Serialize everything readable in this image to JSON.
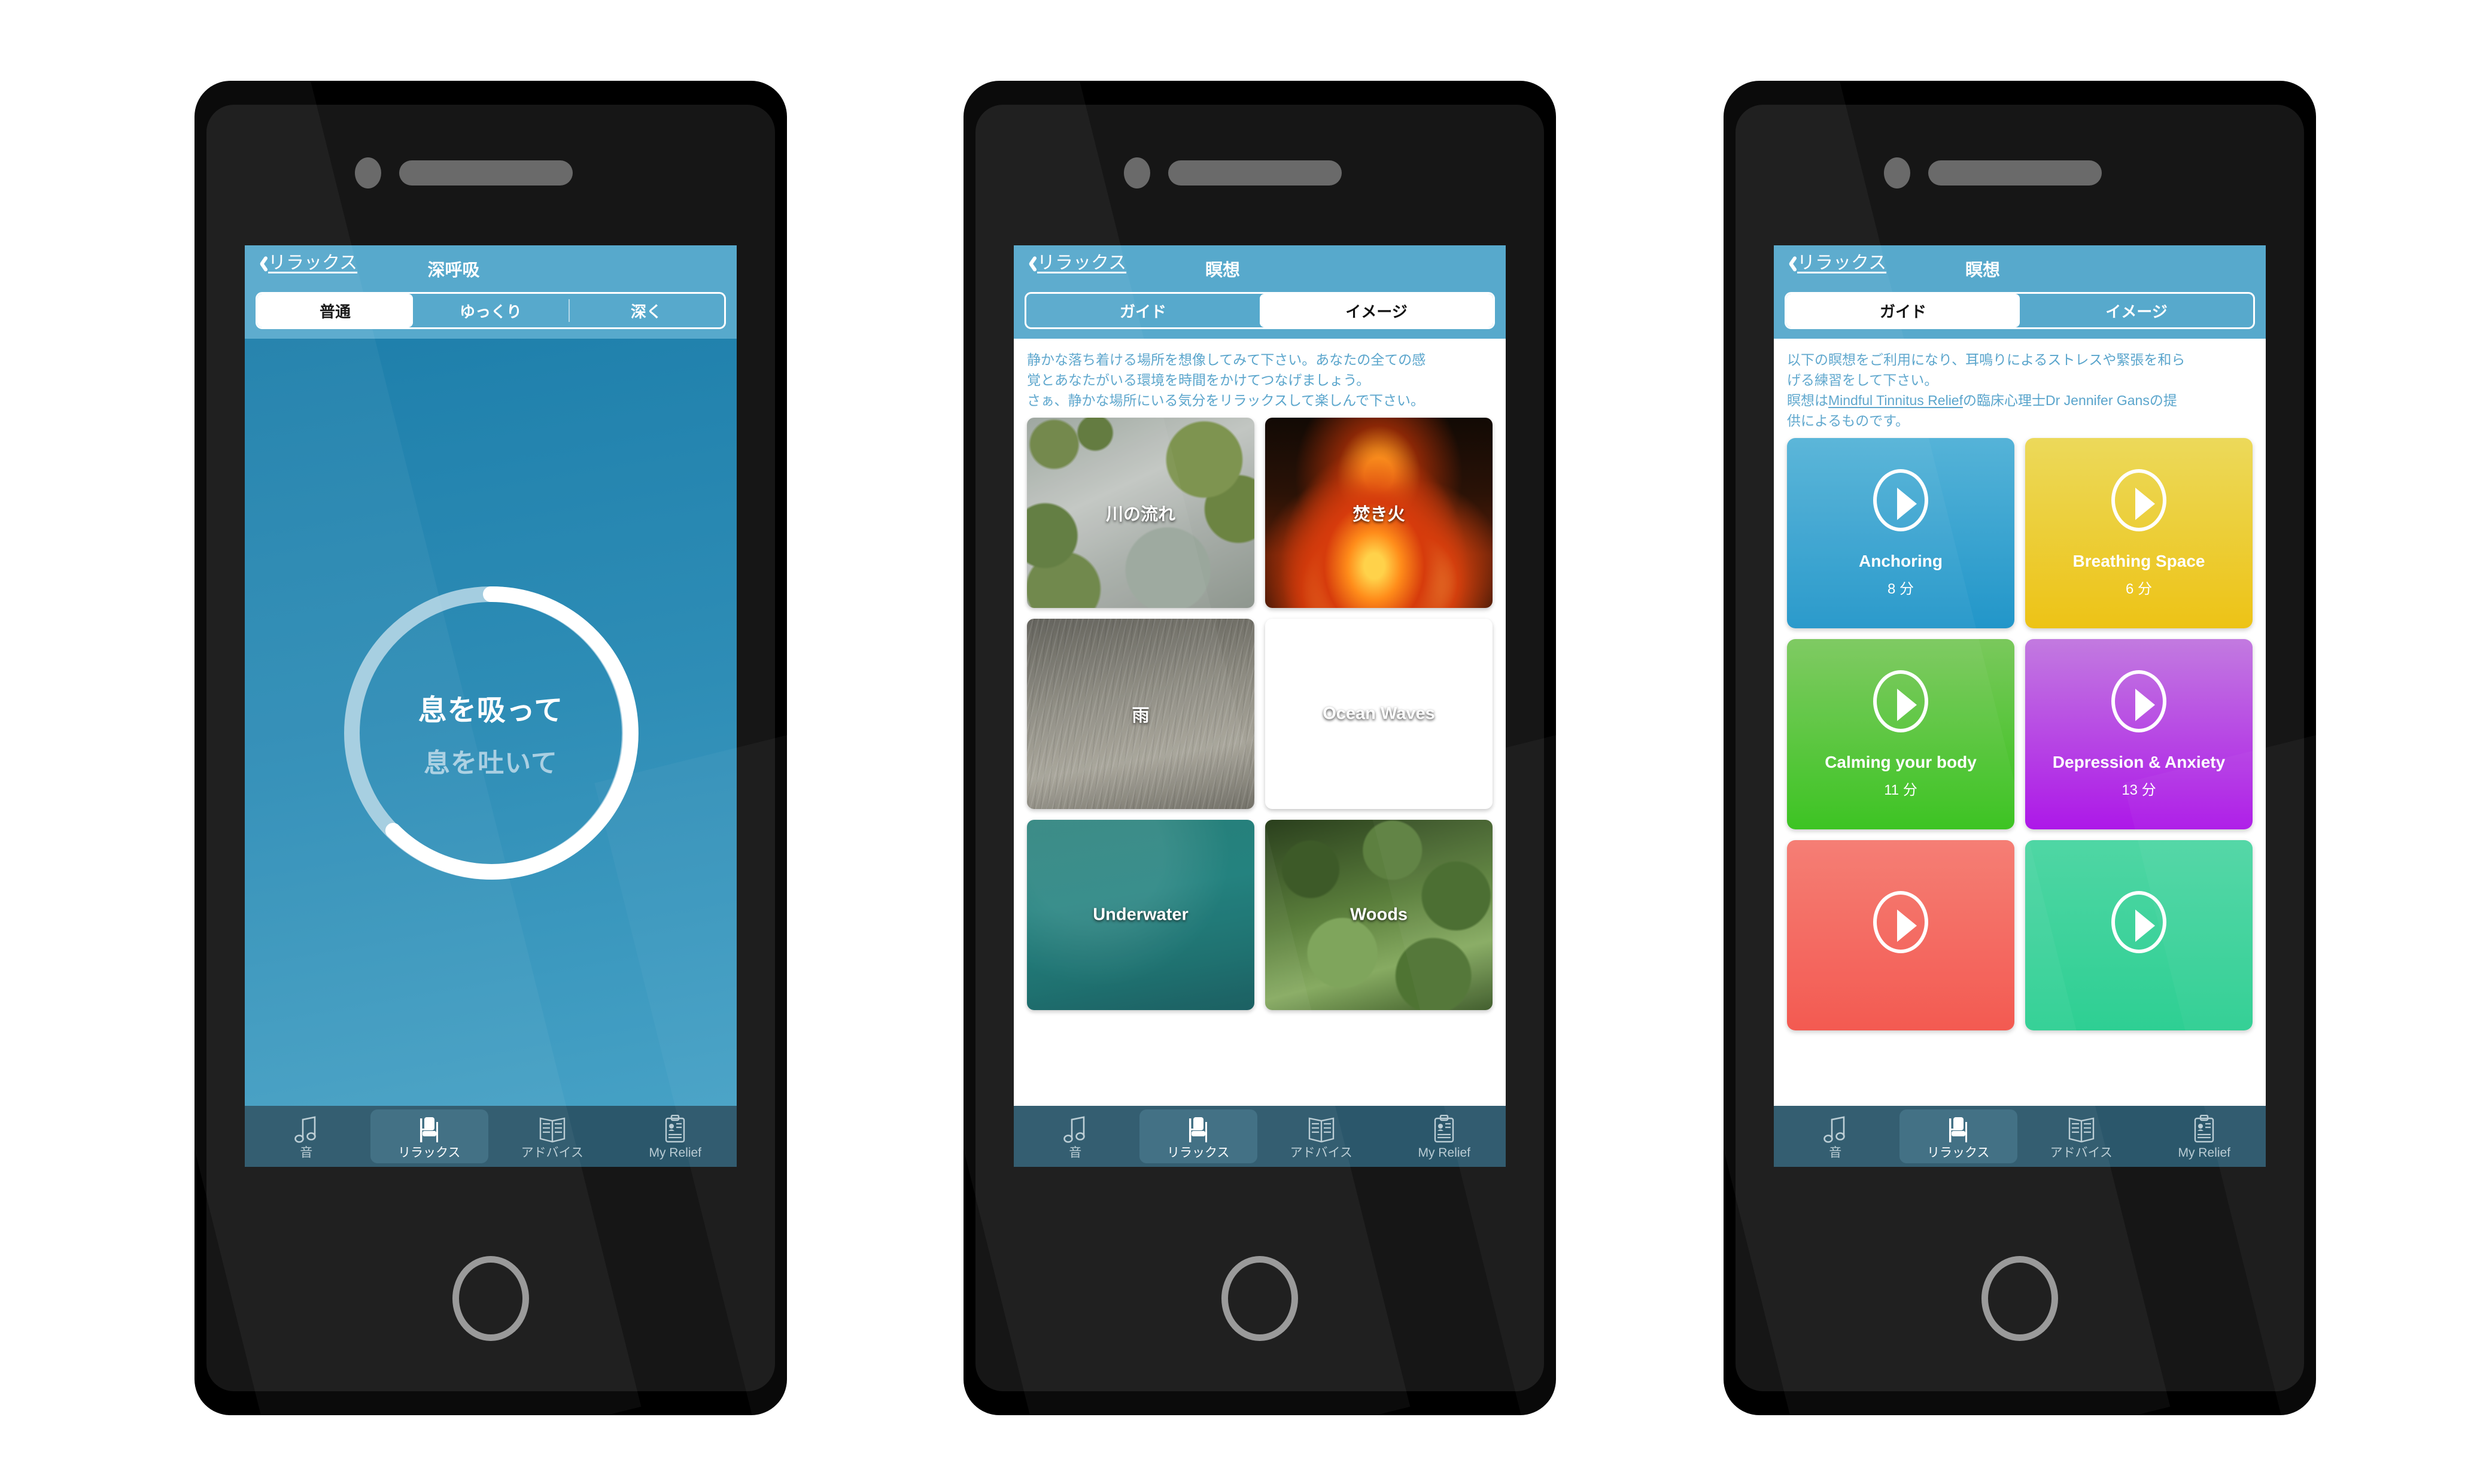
{
  "app": {
    "accent_blue": "#57a9cc",
    "tabbar_bg": "#2b576b",
    "tabbar_active_bg": "#3b6b80"
  },
  "tabbar": {
    "items": [
      {
        "icon": "music-note-icon",
        "label": "音",
        "active": false
      },
      {
        "icon": "chair-icon",
        "label": "リラックス",
        "active": true
      },
      {
        "icon": "book-icon",
        "label": "アドバイス",
        "active": false
      },
      {
        "icon": "clipboard-icon",
        "label": "My Relief",
        "active": false
      }
    ]
  },
  "phone1": {
    "nav": {
      "back_label": "リラックス",
      "title": "深呼吸"
    },
    "segments": [
      {
        "label": "普通",
        "active": true
      },
      {
        "label": "ゆっくり",
        "active": false
      },
      {
        "label": "深く",
        "active": false
      }
    ],
    "breathing": {
      "inhale_text": "息を吸って",
      "exhale_text": "息を吐いて",
      "progress_percent": 78,
      "track_color": "#a4cde0",
      "progress_color": "#ffffff",
      "background_from": "#1e7fab",
      "background_to": "#47a2c6"
    }
  },
  "phone2": {
    "nav": {
      "back_label": "リラックス",
      "title": "瞑想"
    },
    "segments": [
      {
        "label": "ガイド",
        "active": false
      },
      {
        "label": "イメージ",
        "active": true
      }
    ],
    "intro": {
      "line1": "静かな落ち着ける場所を想像してみて下さい。あなたの全ての感",
      "line2": "覚とあなたがいる環境を時間をかけてつなげましょう。",
      "line3": "さぁ、静かな場所にいる気分をリラックスして楽しんで下さい。"
    },
    "tiles": [
      {
        "label": "川の流れ",
        "texture": "ph-river"
      },
      {
        "label": "焚き火",
        "texture": "ph-fire"
      },
      {
        "label": "雨",
        "texture": "ph-rain"
      },
      {
        "label": "Ocean Waves",
        "texture": "ph-ocean"
      },
      {
        "label": "Underwater",
        "texture": "ph-under"
      },
      {
        "label": "Woods",
        "texture": "ph-woods"
      }
    ]
  },
  "phone3": {
    "nav": {
      "back_label": "リラックス",
      "title": "瞑想"
    },
    "segments": [
      {
        "label": "ガイド",
        "active": true
      },
      {
        "label": "イメージ",
        "active": false
      }
    ],
    "intro": {
      "line1": "以下の瞑想をご利用になり、耳鳴りによるストレスや緊張を和ら",
      "line2": "げる練習をして下さい。",
      "line3_pre": "瞑想は",
      "line3_link": "Mindful Tinnitus Relief",
      "line3_post": "の臨床心理士Dr Jennifer Gansの提",
      "line4": "供によるものです。"
    },
    "cards": [
      {
        "title": "Anchoring",
        "duration": "8 分",
        "color": "c-blue"
      },
      {
        "title": "Breathing Space",
        "duration": "6 分",
        "color": "c-yellow"
      },
      {
        "title": "Calming your body",
        "duration": "11 分",
        "color": "c-green"
      },
      {
        "title": "Depression & Anxiety",
        "duration": "13 分",
        "color": "c-purple"
      },
      {
        "title": "",
        "duration": "",
        "color": "c-red"
      },
      {
        "title": "",
        "duration": "",
        "color": "c-teal"
      }
    ]
  }
}
